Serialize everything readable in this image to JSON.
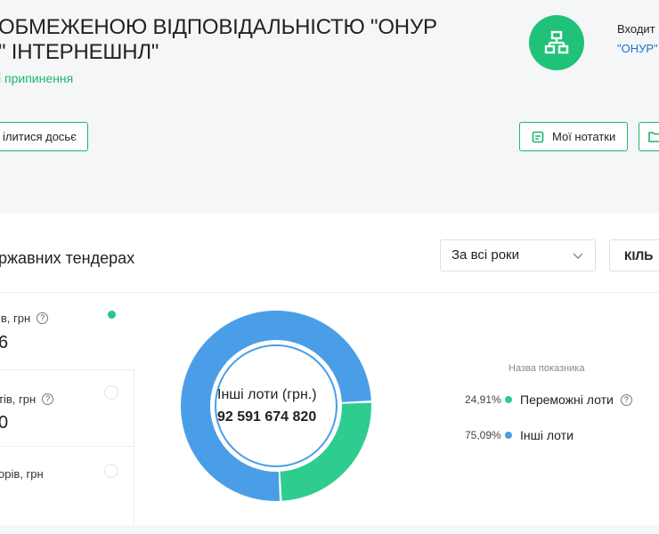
{
  "header": {
    "company_line1": "ОБМЕЖЕНОЮ ВІДПОВІДАЛЬНІСТЮ \"ОНУР",
    "company_line2": "\" ІНТЕРНЕШНЛ\"",
    "status": "і припинення",
    "share_button": "ілитися досьє",
    "included_label": "Входит",
    "included_link": "\"ОНУР\"",
    "notes_button": "Мої нотатки"
  },
  "tenders": {
    "title": "ржавних тендерах",
    "year_select": "За всі роки",
    "kind_button": "КІЛЬ",
    "metrics": [
      {
        "label": "ів, грн",
        "value": "6",
        "selected": true,
        "help": true
      },
      {
        "label": "тів, грн",
        "value": "0",
        "selected": false,
        "help": true
      },
      {
        "label": "орів, грн",
        "value": "",
        "selected": false,
        "help": false
      }
    ],
    "donut_center_label": "Інші лоти (грн.)",
    "donut_center_value": "92 591 674 820",
    "legend_title": "Назва показника",
    "legend": [
      {
        "pct": "24,91%",
        "name": "Переможні лоти",
        "color": "#2ecc8f",
        "help": true
      },
      {
        "pct": "75,09%",
        "name": "Інші лоти",
        "color": "#4a9ee8",
        "help": false
      }
    ]
  },
  "chart_data": {
    "type": "pie",
    "categories": [
      "Переможні лоти",
      "Інші лоти"
    ],
    "values": [
      24.91,
      75.09
    ],
    "title": "",
    "legend_title": "Назва показника",
    "colors": [
      "#2ecc8f",
      "#4a9ee8"
    ]
  }
}
